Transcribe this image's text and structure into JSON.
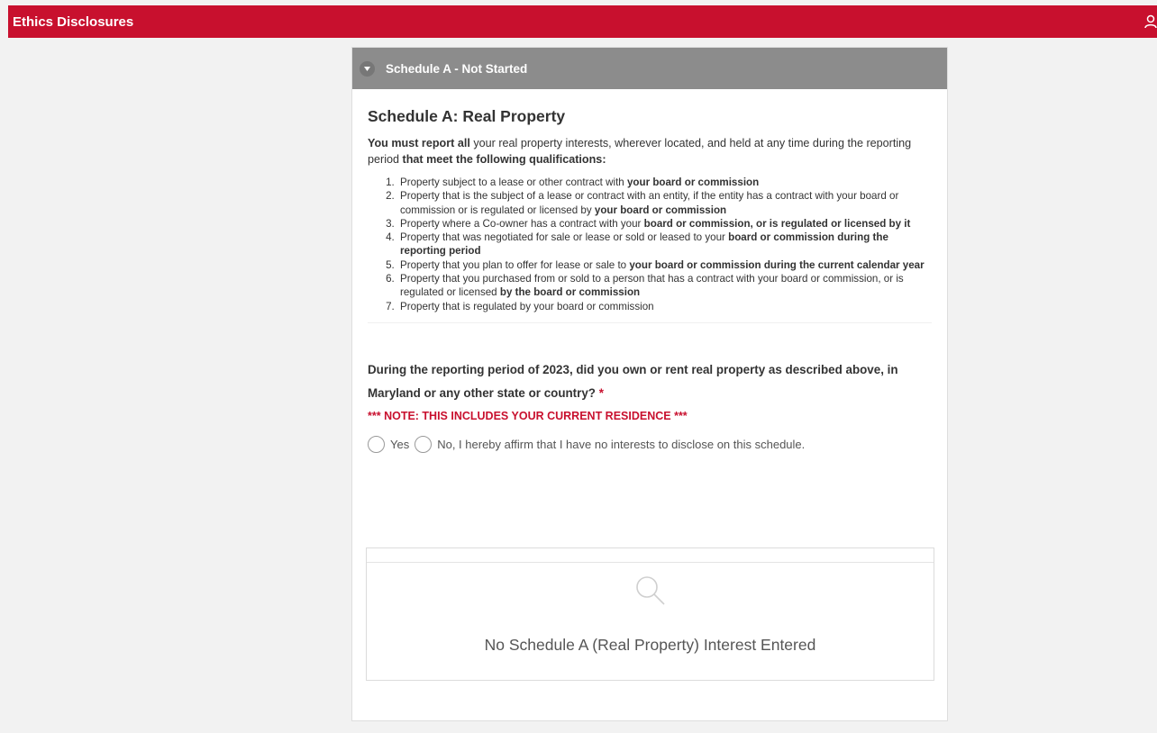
{
  "app": {
    "title": "Ethics Disclosures"
  },
  "section": {
    "header_label": "Schedule A - Not Started",
    "title": "Schedule A: Real Property",
    "intro": {
      "p1_bold": "You must report all",
      "p2": " your real property interests, wherever located, and held at any time during the reporting period ",
      "p3_bold": "that meet the following qualifications:"
    },
    "qualifications": [
      {
        "parts": [
          {
            "t": "Property subject to a lease or other contract with "
          },
          {
            "t": "your board or commission",
            "b": true
          }
        ]
      },
      {
        "parts": [
          {
            "t": "Property that is the subject of a lease or contract with an entity, if the entity has a contract with your board or commission or is regulated or licensed by "
          },
          {
            "t": "your board or commission",
            "b": true
          }
        ]
      },
      {
        "parts": [
          {
            "t": "Property where a Co-owner has a contract with your "
          },
          {
            "t": "board or commission, or is regulated or licensed by it",
            "b": true
          }
        ]
      },
      {
        "parts": [
          {
            "t": "Property that was negotiated for sale or lease or sold or leased to your "
          },
          {
            "t": "board or commission during the reporting period",
            "b": true
          }
        ]
      },
      {
        "parts": [
          {
            "t": "Property that you plan to offer for lease or sale to "
          },
          {
            "t": "your board or commission during the current calendar year",
            "b": true
          }
        ]
      },
      {
        "parts": [
          {
            "t": "Property that you purchased from or sold to a person that has a contract with your board or commission, or is regulated or licensed "
          },
          {
            "t": "by the board or commission",
            "b": true
          }
        ]
      },
      {
        "parts": [
          {
            "t": "Property that is regulated by your board or commission"
          }
        ]
      }
    ],
    "question": "During the reporting period of 2023, did you own or rent real property as described above, in Maryland or any other state or country?",
    "required_mark": " *",
    "note": "*** NOTE: THIS INCLUDES YOUR CURRENT RESIDENCE ***",
    "options": {
      "yes_label": "Yes",
      "no_label": "No, I hereby affirm that I have no interests to disclose on this schedule."
    },
    "empty_message": "No Schedule A (Real Property) Interest Entered"
  },
  "colors": {
    "brand_red": "#c8102e",
    "header_gray": "#8c8c8c"
  },
  "icons": {
    "user": "user-icon",
    "chevron": "chevron-down-icon",
    "search": "search-icon"
  }
}
